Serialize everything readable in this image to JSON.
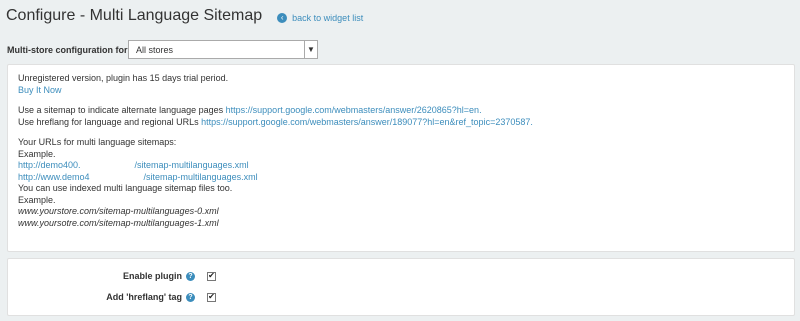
{
  "header": {
    "title": "Configure - Multi Language Sitemap",
    "back_label": "back to widget list"
  },
  "store_config": {
    "label": "Multi-store configuration for",
    "selected": "All stores"
  },
  "info": {
    "trial_notice": "Unregistered version, plugin has 15 days trial period.",
    "buy_now": "Buy It Now",
    "sitemap_text": "Use a sitemap to indicate alternate language pages",
    "sitemap_url": "https://support.google.com/webmasters/answer/2620865?hl=en.",
    "hreflang_text": "Use hreflang for language and regional URLs",
    "hreflang_url": "https://support.google.com/webmasters/answer/189077?hl=en&ref_topic=2370587.",
    "urls_heading": "Your URLs for multi language sitemaps:",
    "example1": "Example.",
    "url1": "http://demo400.      /sitemap-multilanguages.xml",
    "url2": "http://www.demo4      /sitemap-multilanguages.xml",
    "indexed_text": "You can use indexed multi language sitemap files too.",
    "example2": "Example.",
    "indexed1": "www.yourstore.com/sitemap-multilanguages-0.xml",
    "indexed2": "www.yoursotre.com/sitemap-multilanguages-1.xml"
  },
  "options": {
    "enable_label": "Enable plugin",
    "enable_checked": true,
    "hreflang_label": "Add 'hreflang' tag",
    "hreflang_checked": true
  },
  "colors": {
    "accent": "#3c8dbc",
    "background": "#ecf0f1"
  }
}
